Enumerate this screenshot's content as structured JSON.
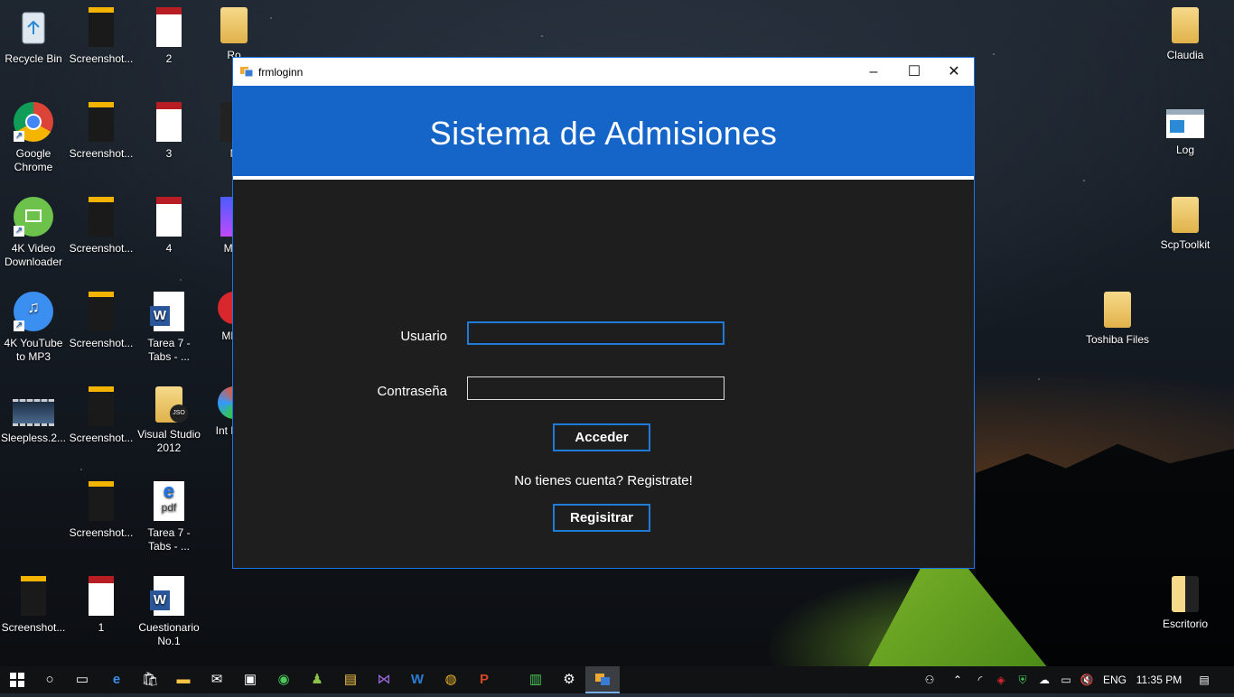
{
  "desktop": {
    "icons": [
      {
        "label": "Recycle Bin",
        "icon": "recycle-bin-icon"
      },
      {
        "label": "Screenshot...",
        "icon": "screenshot-icon"
      },
      {
        "label": "2",
        "icon": "pdf-icon"
      },
      {
        "label": "Ro",
        "icon": "folder-icon"
      },
      {
        "label": "Google Chrome",
        "icon": "chrome-icon"
      },
      {
        "label": "Screenshot...",
        "icon": "screenshot-icon"
      },
      {
        "label": "3",
        "icon": "pdf-icon"
      },
      {
        "label": "N",
        "icon": "app-icon"
      },
      {
        "label": "4K Video Downloader",
        "icon": "4k-video-downloader-icon"
      },
      {
        "label": "Screenshot...",
        "icon": "screenshot-icon"
      },
      {
        "label": "4",
        "icon": "pdf-icon"
      },
      {
        "label": "Mult",
        "icon": "app-icon"
      },
      {
        "label": "4K YouTube to MP3",
        "icon": "4k-youtube-to-mp3-icon"
      },
      {
        "label": "Screenshot...",
        "icon": "screenshot-icon"
      },
      {
        "label": "Tarea 7 - Tabs - ...",
        "icon": "word-document-icon"
      },
      {
        "label": "MEG",
        "icon": "mega-icon"
      },
      {
        "label": "Sleepless.2...",
        "icon": "video-file-icon"
      },
      {
        "label": "Screenshot...",
        "icon": "screenshot-icon"
      },
      {
        "label": "Visual Studio 2012",
        "icon": "json-file-icon"
      },
      {
        "label": "Int Dow",
        "icon": "app-icon"
      },
      {
        "label": "Screenshot...",
        "icon": "screenshot-icon"
      },
      {
        "label": "Tarea 7 - Tabs - ...",
        "icon": "pdf-edge-icon"
      },
      {
        "label": "Screenshot...",
        "icon": "screenshot-icon"
      },
      {
        "label": "1",
        "icon": "pdf-icon"
      },
      {
        "label": "Cuestionario No.1",
        "icon": "word-document-icon"
      },
      {
        "label": "Claudia",
        "icon": "folder-icon"
      },
      {
        "label": "Log",
        "icon": "log-file-icon"
      },
      {
        "label": "ScpToolkit",
        "icon": "folder-icon"
      },
      {
        "label": "Toshiba Files",
        "icon": "folder-icon"
      },
      {
        "label": "Escritorio",
        "icon": "folder-icon"
      }
    ]
  },
  "window": {
    "title": "frmloginn",
    "minimize": "–",
    "maximize": "☐",
    "close": "✕",
    "banner_title": "Sistema de Admisiones",
    "usuario_label": "Usuario",
    "usuario_value": "",
    "password_label": "Contraseña",
    "password_value": "",
    "login_button": "Acceder",
    "register_prompt": "No tienes cuenta? Registrate!",
    "register_button": "Regisitrar"
  },
  "taskbar": {
    "language": "ENG",
    "time": "11:35 PM",
    "accent": "#1565c8"
  }
}
